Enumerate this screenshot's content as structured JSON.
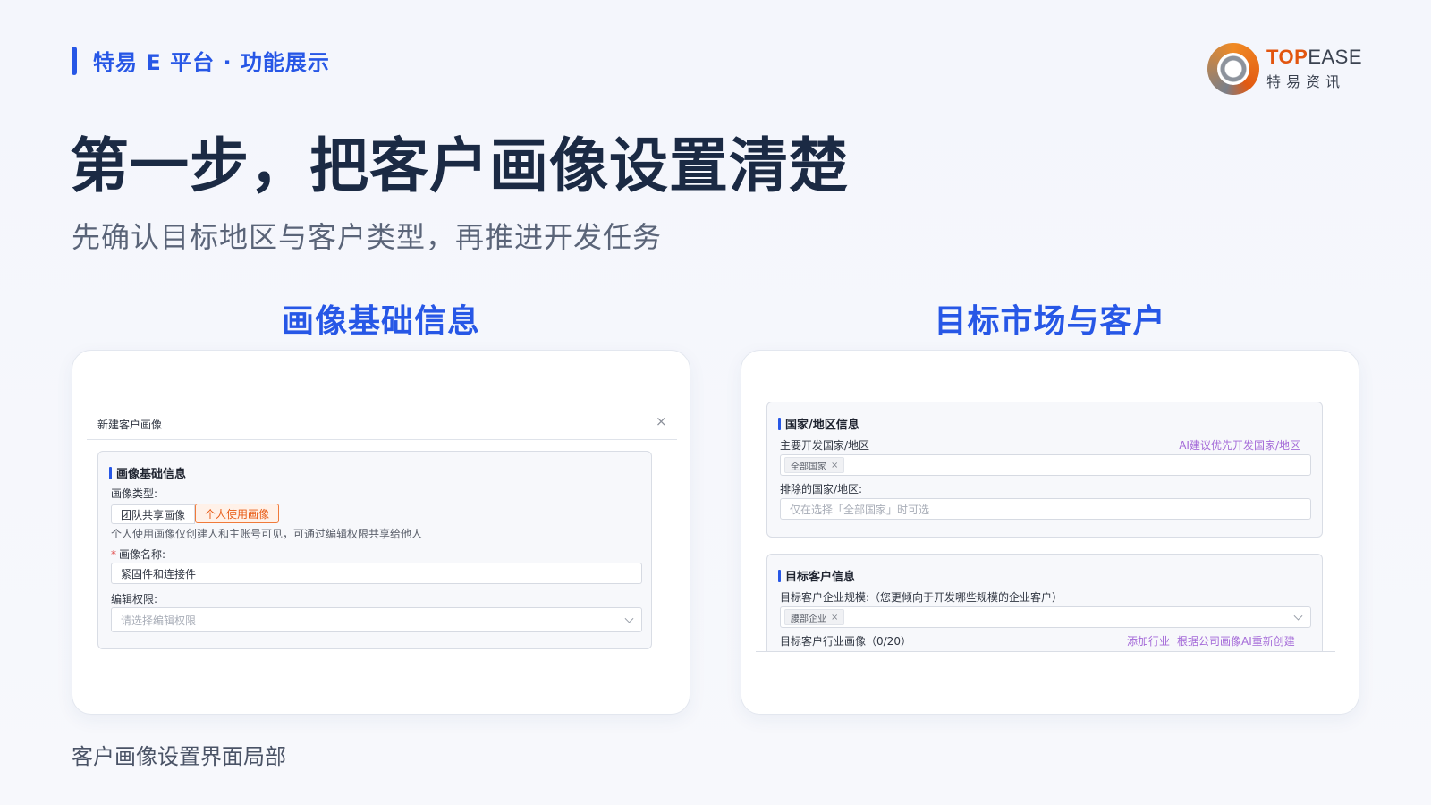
{
  "header": {
    "brand_text": "特易 E 平台 · 功能展示",
    "logo_en_top": "TOP",
    "logo_en_ease": "EASE",
    "logo_cn": "特易资讯",
    "logo_icon": "topease-ring-logo-icon"
  },
  "headline": "第一步，把客户画像设置清楚",
  "subline": "先确认目标地区与客户类型，再推进开发任务",
  "sections": {
    "left_title": "画像基础信息",
    "right_title": "目标市场与客户"
  },
  "left_card": {
    "dialog_title": "新建客户画像",
    "close_icon": "×",
    "panel_title": "画像基础信息",
    "type_label": "画像类型:",
    "type_options": [
      "团队共享画像",
      "个人使用画像"
    ],
    "type_selected": "个人使用画像",
    "type_hint": "个人使用画像仅创建人和主账号可见，可通过编辑权限共享给他人",
    "name_required_mark": "*",
    "name_label": "画像名称:",
    "name_value": "紧固件和连接件",
    "perm_label": "编辑权限:",
    "perm_placeholder": "请选择编辑权限"
  },
  "right_card": {
    "country_panel_title": "国家/地区信息",
    "main_country_label": "主要开发国家/地区",
    "ai_suggest_link": "AI建议优先开发国家/地区",
    "main_country_tag": "全部国家",
    "exclude_label": "排除的国家/地区:",
    "exclude_placeholder": "仅在选择「全部国家」时可选",
    "customer_panel_title": "目标客户信息",
    "scale_label": "目标客户企业规模:（您更倾向于开发哪些规模的企业客户）",
    "scale_tag": "腰部企业",
    "industry_label": "目标客户行业画像（0/20）",
    "add_industry_link": "添加行业",
    "ai_recreate_link": "根据公司画像AI重新创建"
  },
  "caption": "客户画像设置界面局部",
  "colors": {
    "brand_blue": "#2757e6",
    "headline": "#1b2a44",
    "accent_orange": "#e85a14",
    "link_purple": "#a46ad8"
  }
}
